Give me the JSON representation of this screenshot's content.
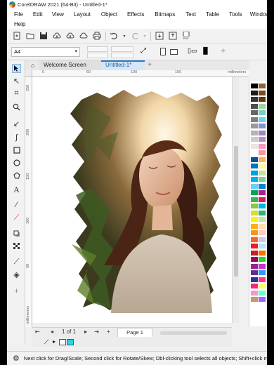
{
  "window": {
    "title": "CorelDRAW 2021 (64-Bit) - Untitled-1*"
  },
  "menu": {
    "row1": [
      "File",
      "Edit",
      "View",
      "Layout",
      "Object",
      "Effects",
      "Bitmaps",
      "Text",
      "Table",
      "Tools",
      "Window"
    ],
    "row2": [
      "Help"
    ]
  },
  "toolbar": {
    "icons": [
      "new-doc-icon",
      "open-folder-icon",
      "save-icon",
      "cloud-upload-icon",
      "cloud-download-icon",
      "cloud-sync-icon",
      "print-icon",
      "undo-icon",
      "redo-icon",
      "import-icon",
      "export-icon",
      "publish-pdf-icon"
    ],
    "pdf_label": "PDF"
  },
  "property_bar": {
    "page_size": "A4",
    "add_preset_symbol": "+"
  },
  "tabs": {
    "welcome": "Welcome Screen",
    "document": "Untitled-1*",
    "add": "+"
  },
  "ruler": {
    "h_ticks": [
      "0",
      "50",
      "100",
      "150"
    ],
    "h_unit": "millimeters",
    "v_ticks": [
      "250",
      "200",
      "150",
      "100",
      "50"
    ],
    "v_unit": "millimeters"
  },
  "page_nav": {
    "first": "⇤",
    "prev": "◂",
    "page_count": "1 of 1",
    "next": "▸",
    "last": "⇥",
    "add_page": "+",
    "page_tab": "Page 1"
  },
  "status": {
    "message": "Next click for Drag/Scale; Second click for Rotate/Skew; Dbl-clicking tool selects all objects; Shift+click mu"
  },
  "colors": {
    "accent": "#2f78c4",
    "fill_swatch": "#2ad4e8",
    "palette": [
      "#000000",
      "#1a1a1a",
      "#333333",
      "#4d4d4d",
      "#666666",
      "#808080",
      "#999999",
      "#b3b3b3",
      "#cccccc",
      "#e6e6e6",
      "#ffffff",
      "#00529b",
      "#0072bc",
      "#00a0dc",
      "#00aeef",
      "#6dcff6",
      "#00a651",
      "#39b54a",
      "#8dc63f",
      "#d7df23",
      "#fff200",
      "#fcaf17",
      "#f7941d",
      "#f26522",
      "#ed1c24",
      "#be1e2d",
      "#9e005d",
      "#92278f",
      "#662d91",
      "#2e3192",
      "#ee2a7b",
      "#f49ac1",
      "#c49a6c",
      "#8c6239",
      "#754c24",
      "#603913",
      "#a3d39c",
      "#7accc8",
      "#6ecff6",
      "#8493ca",
      "#a186be",
      "#bd8cbf",
      "#f49ac2",
      "#f6989d",
      "#fbaf5d",
      "#fff799",
      "#c4df9b",
      "#82ca9c",
      "#0089d0",
      "#ab218e",
      "#d91c5c",
      "#00b5e2",
      "#2bb673",
      "#c5e1a5",
      "#ffe0b2",
      "#ffccbc",
      "#d1c4e9",
      "#b3e5fc",
      "#ff6f00",
      "#33cc33",
      "#cc33cc",
      "#3399ff",
      "#ff3399",
      "#ffff66",
      "#66ffcc",
      "#9966ff"
    ]
  }
}
